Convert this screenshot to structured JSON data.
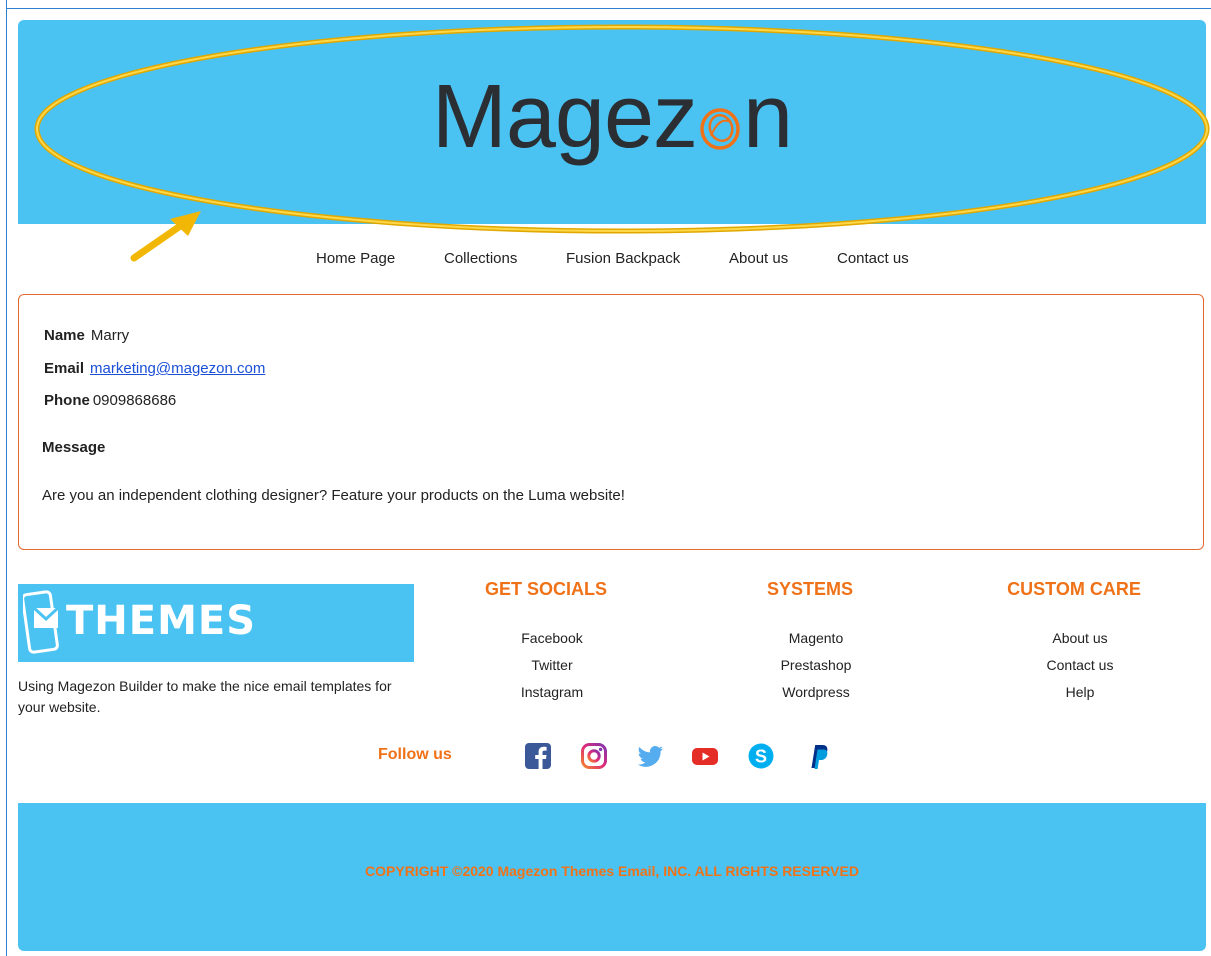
{
  "header": {
    "logo_text": "Magez",
    "logo_tail": "n",
    "logo_o": "o"
  },
  "nav": [
    {
      "label": "Home Page"
    },
    {
      "label": "Collections"
    },
    {
      "label": "Fusion Backpack"
    },
    {
      "label": "About us"
    },
    {
      "label": "Contact us"
    }
  ],
  "contact": {
    "name_label": "Name",
    "name_value": "Marry",
    "email_label": "Email",
    "email_value": "marketing@magezon.com",
    "phone_label": "Phone",
    "phone_value": "0909868686",
    "message_label": "Message",
    "message_text": "Are you an independent clothing designer? Feature your products on the Luma website!"
  },
  "brand": {
    "themes_label": "THEMES",
    "description": "Using Magezon Builder to make the nice email templates for your website."
  },
  "columns": [
    {
      "title": "GET SOCIALS",
      "links": [
        "Facebook",
        "Twitter",
        "Instagram"
      ]
    },
    {
      "title": "SYSTEMS",
      "links": [
        "Magento",
        "Prestashop",
        "Wordpress"
      ]
    },
    {
      "title": "CUSTOM CARE",
      "links": [
        "About us",
        "Contact us",
        "Help"
      ]
    }
  ],
  "follow": {
    "label": "Follow us",
    "icons": [
      "facebook-icon",
      "instagram-icon",
      "twitter-icon",
      "youtube-icon",
      "skype-icon",
      "paypal-icon"
    ]
  },
  "footer": {
    "copyright": "COPYRIGHT ©2020 Magezon Themes Email, INC. ALL RIGHTS RESERVED"
  },
  "colors": {
    "header_bg": "#4bc3f2",
    "accent_orange": "#f07218",
    "border_orange": "#e36a2e",
    "link_blue": "#1a4fd6",
    "annotation_yellow": "#f2b705"
  }
}
